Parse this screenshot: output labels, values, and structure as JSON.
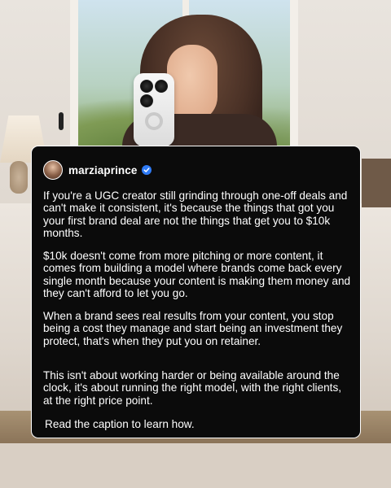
{
  "post": {
    "username": "marziaprince",
    "verified": true,
    "verified_badge_color": "#2f7bf6",
    "paragraphs": [
      "If you're a UGC creator still grinding through one-off deals and can't make it consistent, it's because the things that got you your first brand deal are not the things that get you to $10k months.",
      "$10k doesn't come from more pitching or more content, it comes from building a model where brands come back every single month because your content is making them money and they can't afford to let you go.",
      "When a brand sees real results from your content, you stop being a cost they manage and start being an investment they protect, that's when they put you on retainer.",
      "This isn't about working harder or being available around the clock, it's about running the right model, with the right clients, at the right price point."
    ],
    "cta": "Read the caption to learn how."
  },
  "colors": {
    "card_background": "#0b0b0b",
    "card_border": "#ffffff",
    "text": "#ffffff"
  },
  "icons": {
    "verified": "verified-check-icon",
    "avatar": "profile-avatar"
  }
}
